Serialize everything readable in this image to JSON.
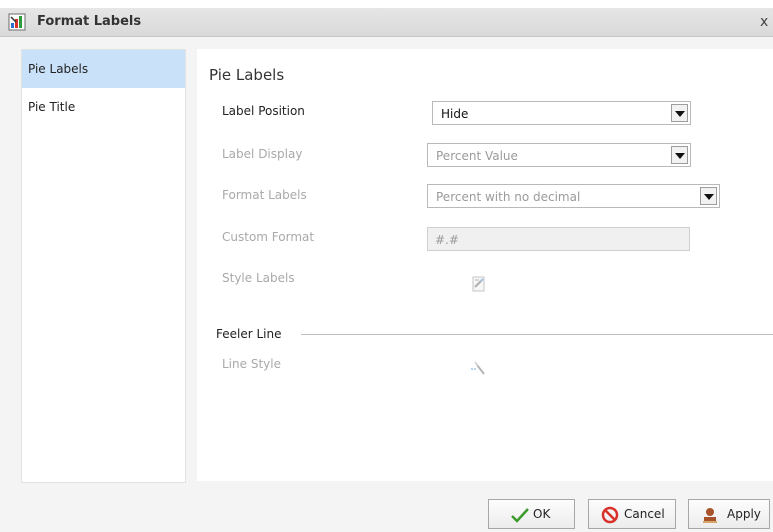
{
  "dialog": {
    "title": "Format Labels",
    "close_glyph": "x"
  },
  "icons": {
    "title": "format-labels-icon",
    "close": "close-icon",
    "style_labels": "style-labels-icon",
    "line_style": "line-style-icon",
    "ok": "checkmark-icon",
    "cancel": "cancel-icon",
    "apply": "apply-icon"
  },
  "sidebar": {
    "items": [
      {
        "label": "Pie Labels",
        "selected": true
      },
      {
        "label": "Pie Title",
        "selected": false
      }
    ]
  },
  "panel": {
    "title": "Pie Labels",
    "label_position": {
      "label": "Label Position",
      "value": "Hide"
    },
    "label_display": {
      "label": "Label Display",
      "value": "Percent Value"
    },
    "format_labels": {
      "label": "Format Labels",
      "value": "Percent with no decimal"
    },
    "custom_format": {
      "label": "Custom Format",
      "value": "#.#"
    },
    "style_labels": {
      "label": "Style Labels"
    },
    "feeler_line": {
      "label": "Feeler Line"
    },
    "line_style": {
      "label": "Line Style"
    }
  },
  "buttons": {
    "ok": "OK",
    "cancel": "Cancel",
    "apply": "Apply"
  },
  "colors": {
    "selected_nav": "#c9e2f9",
    "disabled_text": "#a9a9a9",
    "ok_check": "#3a9a2a",
    "cancel_red": "#d9302b",
    "apply_brown": "#a8532a"
  }
}
